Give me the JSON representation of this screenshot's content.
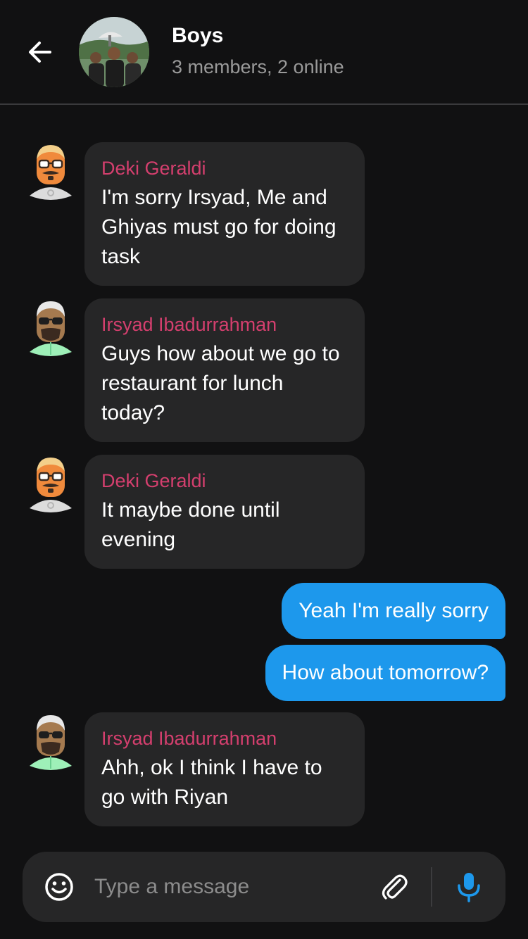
{
  "header": {
    "back_icon": "arrow-left-icon",
    "title": "Boys",
    "subtitle": "3 members, 2 online"
  },
  "messages": [
    {
      "direction": "in",
      "sender": "Deki Geraldi",
      "avatar": "deki-avatar",
      "text": "I'm sorry Irsyad, Me and Ghiyas must go for doing task"
    },
    {
      "direction": "in",
      "sender": "Irsyad Ibadurrahman",
      "avatar": "irsyad-avatar",
      "text": "Guys how about we go to restaurant for lunch today?"
    },
    {
      "direction": "in",
      "sender": "Deki Geraldi",
      "avatar": "deki-avatar",
      "text": "It maybe done until evening"
    },
    {
      "direction": "out",
      "text": "Yeah I'm really sorry"
    },
    {
      "direction": "out",
      "text": "How about tomorrow?"
    },
    {
      "direction": "in",
      "sender": "Irsyad Ibadurrahman",
      "avatar": "irsyad-avatar",
      "text": "Ahh, ok I think I have to go with Riyan"
    }
  ],
  "composer": {
    "placeholder": "Type a message",
    "emoji_icon": "emoji-icon",
    "attach_icon": "paperclip-icon",
    "mic_icon": "microphone-icon"
  },
  "colors": {
    "background": "#111112",
    "bubble_in": "#262627",
    "bubble_out": "#1d98ec",
    "sender_name": "#d43f6e",
    "subtitle": "#9a9a9a",
    "accent": "#1d98ec"
  }
}
